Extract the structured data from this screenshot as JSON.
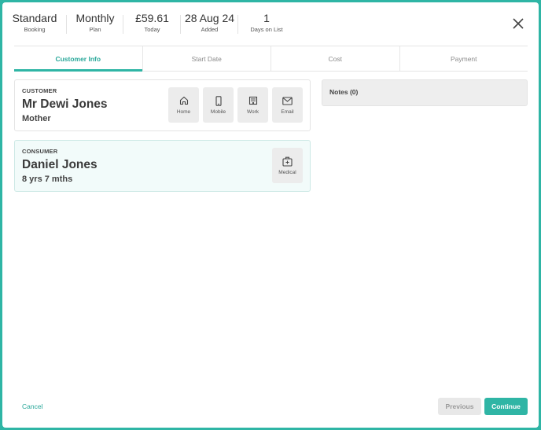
{
  "header": {
    "stats": [
      {
        "value": "Standard",
        "label": "Booking"
      },
      {
        "value": "Monthly",
        "label": "Plan"
      },
      {
        "value": "£59.61",
        "label": "Today"
      },
      {
        "value": "28 Aug 24",
        "label": "Added"
      },
      {
        "value": "1",
        "label": "Days on List"
      }
    ]
  },
  "tabs": [
    {
      "label": "Customer Info",
      "active": true
    },
    {
      "label": "Start Date",
      "active": false
    },
    {
      "label": "Cost",
      "active": false
    },
    {
      "label": "Payment",
      "active": false
    }
  ],
  "customer": {
    "role": "CUSTOMER",
    "name": "Mr Dewi Jones",
    "relation": "Mother",
    "buttons": [
      {
        "label": "Home",
        "icon": "home-icon"
      },
      {
        "label": "Mobile",
        "icon": "mobile-icon"
      },
      {
        "label": "Work",
        "icon": "building-icon"
      },
      {
        "label": "Email",
        "icon": "envelope-icon"
      }
    ]
  },
  "consumer": {
    "role": "CONSUMER",
    "name": "Daniel Jones",
    "age": "8 yrs 7 mths",
    "buttons": [
      {
        "label": "Medical",
        "icon": "medical-kit-icon"
      }
    ]
  },
  "notes": {
    "label": "Notes (0)"
  },
  "footer": {
    "cancel": "Cancel",
    "previous": "Previous",
    "continue": "Continue"
  },
  "colors": {
    "accent": "#2fb5a5",
    "accent_text": "#2aa89a"
  }
}
